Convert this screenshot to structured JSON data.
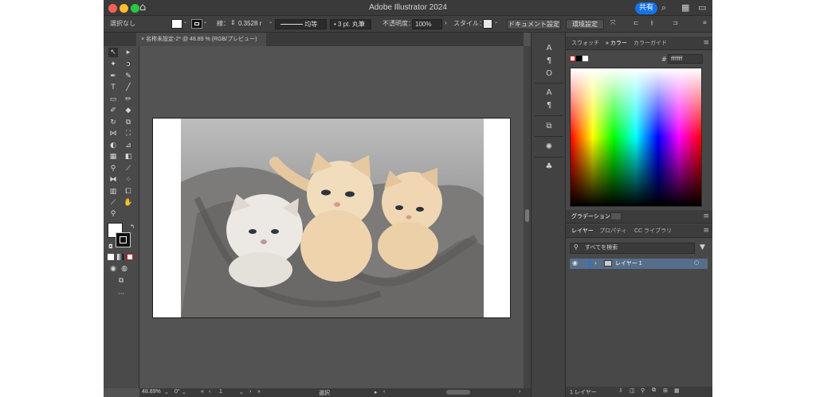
{
  "window": {
    "title": "Adobe Illustrator 2024",
    "share_label": "共有"
  },
  "controlbar": {
    "selection_label": "選択なし",
    "stroke_label": "線：",
    "stroke_weight": "0.3528 r",
    "stroke_profile": "均等",
    "brush": "3 pt. 丸筆",
    "opacity_label": "不透明度：",
    "opacity_value": "100%",
    "style_label": "スタイル：",
    "doc_setup_label": "ドキュメント設定",
    "prefs_label": "環境設定"
  },
  "document": {
    "tab_label": "名称未設定-2* @ 48.89 % (RGB/プレビュー)"
  },
  "status": {
    "zoom": "48.89%",
    "rotation": "0°",
    "artboard": "1",
    "mode": "選択"
  },
  "panels": {
    "color_tabs": [
      "スウォッチ",
      "カラー",
      "カラーガイド"
    ],
    "color_hex": "ffffff",
    "gradient_tab": "グラデーション",
    "layer_tabs": [
      "レイヤー",
      "プロパティ",
      "CC ライブラリ"
    ],
    "search_placeholder": "すべてを検索",
    "layer_name": "レイヤー 1",
    "layer_count": "1 レイヤー"
  },
  "colors": {
    "accent": "#1473e6",
    "layer_highlight": "#566e8a",
    "close": "#ff5f57",
    "minimize": "#febc2e",
    "zoom": "#28c840"
  }
}
